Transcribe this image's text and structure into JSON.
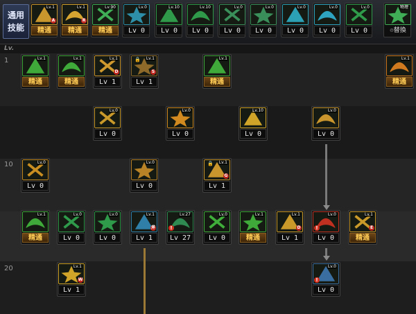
{
  "tab": {
    "line1": "通用",
    "line2": "技能"
  },
  "lv_header": "Lv.",
  "rows": [
    "1",
    "10",
    "20"
  ],
  "swap_label": "♲替換",
  "top_icons": [
    {
      "name": "skill-slot-1-icon",
      "label": "精通",
      "style": "m",
      "tag": "Lv.1",
      "badge": "A",
      "col": "#c9962e"
    },
    {
      "name": "skill-slot-2-icon",
      "label": "精通",
      "style": "m",
      "tag": "Lv.1",
      "badge": "R",
      "col": "#d6a531"
    },
    {
      "name": "skill-slot-3-icon",
      "label": "精通",
      "style": "m",
      "tag": "Lv.90",
      "col": "#3fae57"
    },
    {
      "name": "skill-slot-4-icon",
      "label": "Lv 0",
      "style": "lv",
      "tag": "Lv.0",
      "col": "#2e8fa8"
    },
    {
      "name": "skill-slot-5-icon",
      "label": "Lv 0",
      "style": "lv",
      "tag": "Lv.10",
      "col": "#2f9a4a"
    },
    {
      "name": "skill-slot-6-icon",
      "label": "Lv 0",
      "style": "lv",
      "tag": "Lv.10",
      "col": "#2f9a4a"
    },
    {
      "name": "skill-slot-7-icon",
      "label": "Lv 0",
      "style": "lv",
      "tag": "Lv.0",
      "col": "#3a8e5a"
    },
    {
      "name": "skill-slot-8-icon",
      "label": "Lv 0",
      "style": "lv",
      "tag": "Lv.0",
      "col": "#3a8e5a"
    },
    {
      "name": "skill-slot-9-icon",
      "label": "Lv 0",
      "style": "lv",
      "tag": "Lv.0",
      "col": "#2ca0b4"
    },
    {
      "name": "skill-slot-10-icon",
      "label": "Lv 0",
      "style": "lv",
      "tag": "Lv.0",
      "col": "#2ea4c0"
    },
    {
      "name": "skill-slot-11-icon",
      "label": "Lv 0",
      "style": "lv",
      "tag": "Lv.0",
      "col": "#2f9a4a"
    },
    {
      "name": "physical-swap-icon",
      "label": "♲替換",
      "style": "swap",
      "tag": "物理",
      "col": "#3fae57"
    }
  ],
  "tree_icons": [
    {
      "name": "skill-crit-mastery-icon",
      "label": "精通",
      "style": "m",
      "tag": "Lv.1",
      "col": "#3faa3a"
    },
    {
      "name": "skill-basic-mastery-icon",
      "label": "精通",
      "style": "m",
      "tag": "Lv.1",
      "col": "#3faa3a"
    },
    {
      "name": "skill-dash-d-icon",
      "label": "Lv 1",
      "style": "lv",
      "tag": "Lv.1",
      "badge": "D",
      "col": "#d19a2e"
    },
    {
      "name": "skill-swing-s-icon",
      "label": "Lv 1",
      "style": "lv",
      "tag": "Lv.1",
      "badge": "S",
      "lock": true,
      "col": "#8e6a2a"
    },
    {
      "name": "skill-on-buff-icon",
      "label": "精通",
      "style": "m",
      "tag": "Lv.1",
      "col": "#3faa3a"
    },
    {
      "name": "skill-fire-mastery-icon",
      "label": "精通",
      "style": "m",
      "tag": "Lv.1",
      "col": "#d07a20"
    },
    {
      "name": "skill-burst-icon",
      "label": "Lv 0",
      "style": "lv",
      "tag": "Lv.0",
      "col": "#c99a2a"
    },
    {
      "name": "skill-triple-arrow-icon",
      "label": "Lv 0",
      "style": "lv",
      "tag": "Lv.0",
      "col": "#d08a20"
    },
    {
      "name": "skill-crescent-icon",
      "label": "Lv 0",
      "style": "lv",
      "tag": "Lv.10",
      "col": "#d0a428"
    },
    {
      "name": "skill-shield-icon",
      "label": "Lv 0",
      "style": "lv",
      "tag": "Lv.0",
      "col": "#c9962e"
    },
    {
      "name": "skill-lightning-icon",
      "label": "Lv 0",
      "style": "lv",
      "tag": "Lv.0",
      "col": "#c98e22"
    },
    {
      "name": "skill-ring-icon",
      "label": "Lv 0",
      "style": "lv",
      "tag": "Lv.0",
      "col": "#b88326"
    },
    {
      "name": "skill-guard-g-icon",
      "label": "Lv 1",
      "style": "lv",
      "tag": "Lv.1",
      "badge": "G",
      "lock": true,
      "col": "#c9962e"
    },
    {
      "name": "skill-hand-mastery-icon",
      "label": "精通",
      "style": "m",
      "tag": "Lv.1",
      "col": "#3faa3a"
    },
    {
      "name": "skill-blade-1-icon",
      "label": "Lv 0",
      "style": "lv",
      "tag": "Lv.0",
      "col": "#2e9a4a"
    },
    {
      "name": "skill-blade-2-icon",
      "label": "Lv 0",
      "style": "lv",
      "tag": "Lv.0",
      "col": "#2e9a4a"
    },
    {
      "name": "skill-sword-lv1-icon",
      "label": "Lv 1",
      "style": "lv",
      "tag": "Lv.1",
      "badge": "斧",
      "col": "#2f7fa8"
    },
    {
      "name": "skill-potion-icon",
      "label": "Lv 27",
      "style": "lv",
      "tag": "Lv.27",
      "warn": true,
      "col": "#2e8a50"
    },
    {
      "name": "skill-star-burst-icon",
      "label": "Lv 0",
      "style": "lv",
      "tag": "Lv.0",
      "col": "#3fae3a"
    },
    {
      "name": "skill-cross-mastery-icon",
      "label": "精通",
      "style": "m",
      "tag": "Lv.1",
      "col": "#3faa3a"
    },
    {
      "name": "skill-slash-d-icon",
      "label": "Lv 1",
      "style": "lv",
      "tag": "Lv.1",
      "badge": "D",
      "col": "#c99a2a"
    },
    {
      "name": "skill-rage-icon",
      "label": "Lv 0",
      "style": "lv",
      "tag": "Lv.0",
      "warn": true,
      "col": "#c03020"
    },
    {
      "name": "skill-cross-swords-icon",
      "label": "精通",
      "style": "m",
      "tag": "Lv.1",
      "badge": "E",
      "col": "#c99a2a"
    },
    {
      "name": "skill-whirl-w-icon",
      "label": "Lv 1",
      "style": "lv",
      "tag": "Lv.1",
      "badge": "W",
      "col": "#d0a428"
    },
    {
      "name": "skill-barrier-icon",
      "label": "Lv 0",
      "style": "lv",
      "tag": "Lv.0",
      "warn": true,
      "col": "#3a6ea0"
    }
  ]
}
